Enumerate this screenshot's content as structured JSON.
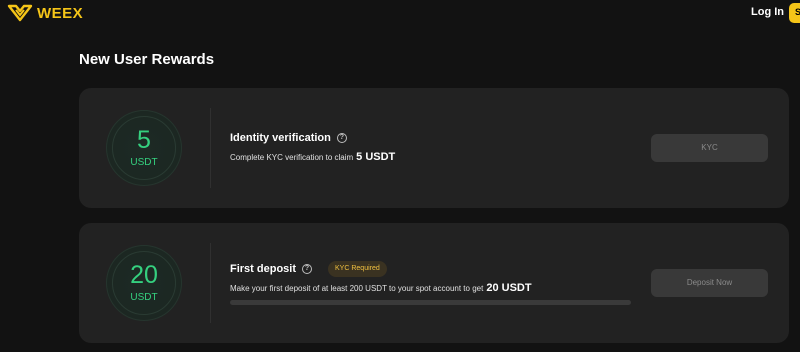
{
  "header": {
    "brand": "WEEX",
    "login_label": "Log In",
    "signup_label": "S",
    "colors": {
      "brand": "#f5c518",
      "background": "#121212"
    }
  },
  "main": {
    "title": "New User Rewards",
    "tasks": [
      {
        "amount": "5",
        "unit": "USDT",
        "title": "Identity verification",
        "description": "Complete KYC verification to claim",
        "reward": "5 USDT",
        "button_label": "KYC",
        "help_icon": "question-circle-icon"
      },
      {
        "amount": "20",
        "unit": "USDT",
        "title": "First deposit",
        "badge": "KYC Required",
        "description": "Make your first deposit of at least 200 USDT to your spot account to get",
        "reward": "20 USDT",
        "progress_fraction": 0,
        "button_label": "Deposit Now",
        "help_icon": "question-circle-icon"
      }
    ],
    "colors": {
      "accent": "#35d07f",
      "card": "#222222",
      "badge_text": "#f0c040"
    }
  }
}
